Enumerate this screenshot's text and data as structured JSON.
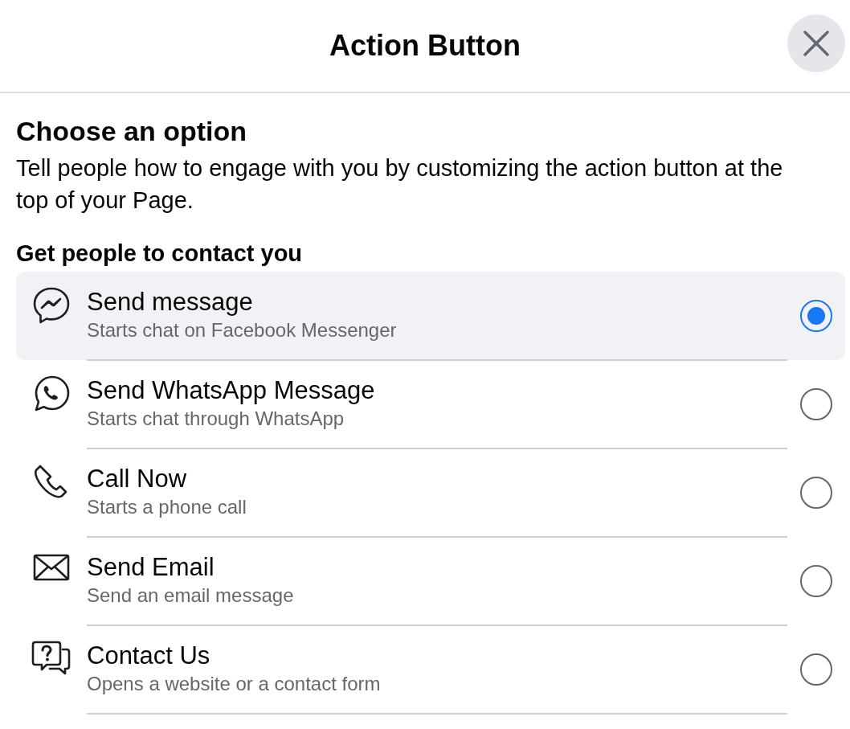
{
  "dialog": {
    "title": "Action Button"
  },
  "heading": "Choose an option",
  "description": "Tell people how to engage with you by customizing the action button at the top of your Page.",
  "section": "Get people to contact you",
  "options": [
    {
      "kind": "messenger",
      "title": "Send message",
      "subtitle": "Starts chat on Facebook Messenger",
      "selected": true
    },
    {
      "kind": "whatsapp",
      "title": "Send WhatsApp Message",
      "subtitle": "Starts chat through WhatsApp",
      "selected": false
    },
    {
      "kind": "phone",
      "title": "Call Now",
      "subtitle": "Starts a phone call",
      "selected": false
    },
    {
      "kind": "email",
      "title": "Send Email",
      "subtitle": "Send an email message",
      "selected": false
    },
    {
      "kind": "question",
      "title": "Contact Us",
      "subtitle": "Opens a website or a contact form",
      "selected": false
    }
  ]
}
